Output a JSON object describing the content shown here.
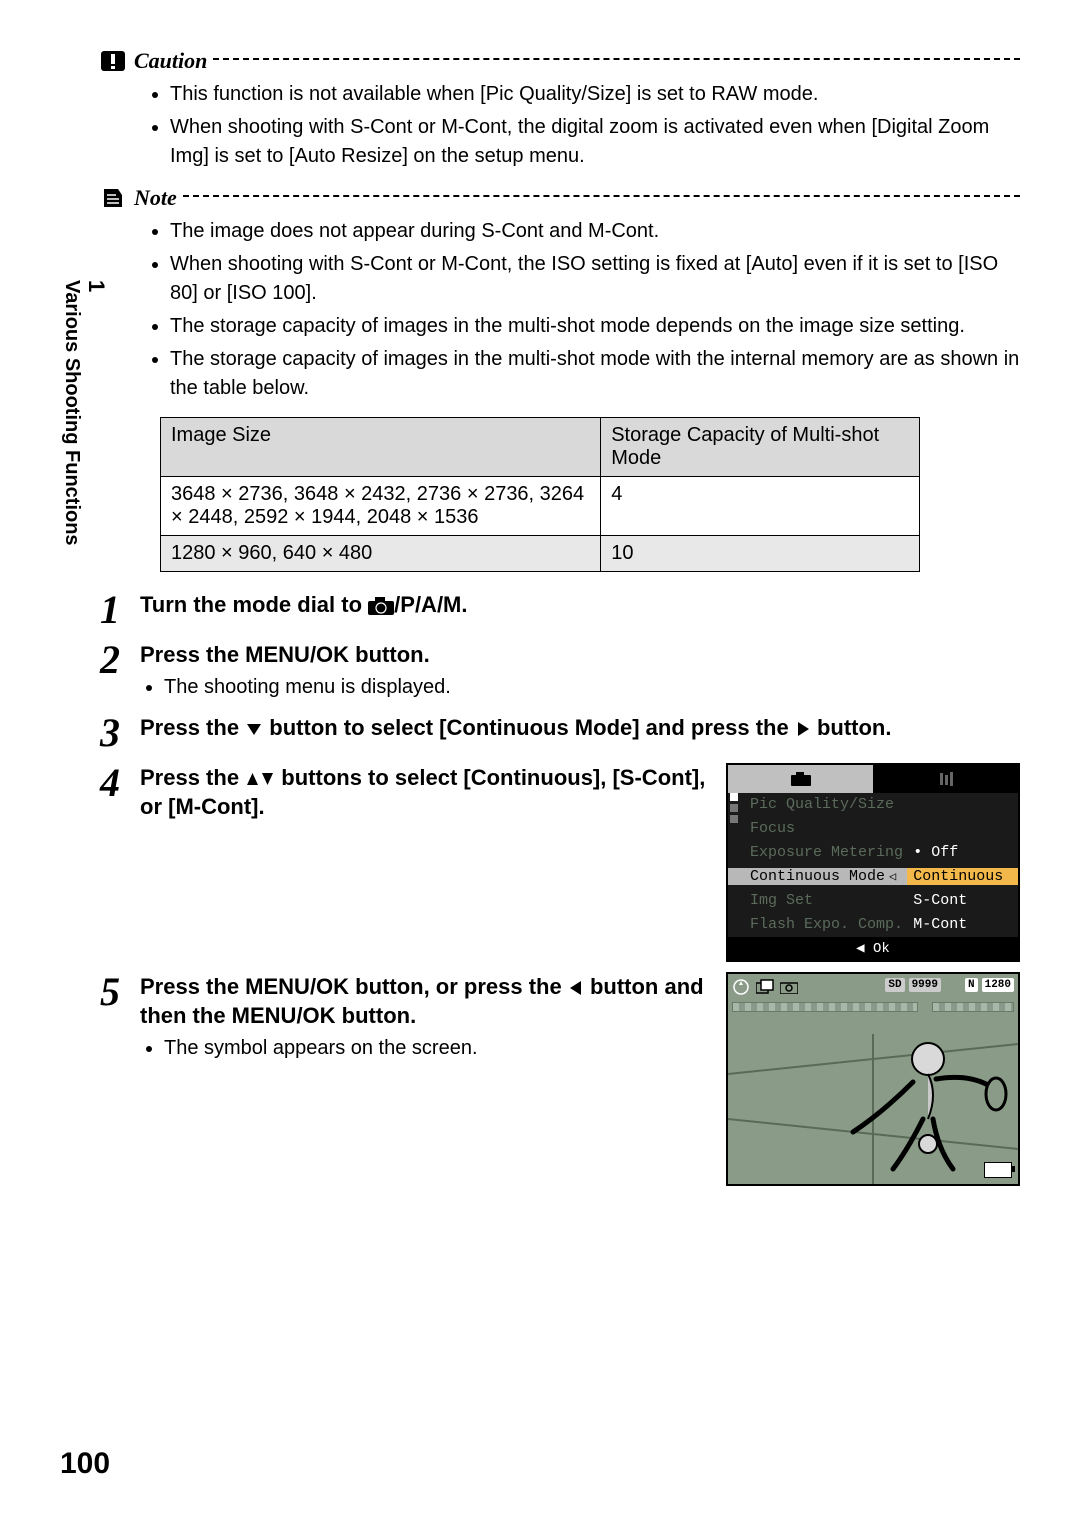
{
  "side": {
    "num": "1",
    "title": "Various Shooting Functions"
  },
  "caution": {
    "heading": "Caution",
    "items": [
      "This function is not available when [Pic Quality/Size] is set to RAW mode.",
      "When shooting with S-Cont or M-Cont, the digital zoom is activated even when [Digital Zoom Img] is set to [Auto Resize] on the setup menu."
    ]
  },
  "note": {
    "heading": "Note",
    "items": [
      "The image does not appear during S-Cont and M-Cont.",
      "When shooting with S-Cont or M-Cont, the ISO setting is fixed at [Auto] even if it is set to [ISO 80] or [ISO 100].",
      "The storage capacity of images in the multi-shot mode depends on the image size setting.",
      "The storage capacity of images in the multi-shot mode with the internal memory are as shown in the table below."
    ]
  },
  "table": {
    "headers": [
      "Image Size",
      "Storage Capacity of Multi-shot Mode"
    ],
    "rows": [
      [
        "3648 × 2736, 3648 × 2432, 2736 × 2736, 3264 × 2448, 2592 × 1944, 2048 × 1536",
        "4"
      ],
      [
        "1280 × 960, 640 × 480",
        "10"
      ]
    ]
  },
  "steps": [
    {
      "num": "1",
      "title_pre": "Turn the mode dial to ",
      "title_post": "/P/A/M."
    },
    {
      "num": "2",
      "title": "Press the MENU/OK button.",
      "bullets": [
        "The shooting menu is displayed."
      ]
    },
    {
      "num": "3",
      "title_parts": [
        "Press the ",
        " button to select [Continuous Mode] and press the ",
        " button."
      ]
    },
    {
      "num": "4",
      "title_parts": [
        "Press the ",
        " buttons to select [Continuous], [S-Cont], or [M-Cont]."
      ]
    },
    {
      "num": "5",
      "title_parts": [
        "Press the MENU/OK button, or press the ",
        " button and then the MENU/OK button."
      ],
      "bullets": [
        "The symbol appears on the screen."
      ]
    }
  ],
  "menu": {
    "items": [
      {
        "l": "Pic Quality/Size",
        "r": ""
      },
      {
        "l": "Focus",
        "r": ""
      },
      {
        "l": "Exposure Metering",
        "r": "• Off"
      },
      {
        "l": "Continuous Mode",
        "r": "Continuous",
        "sel": true
      },
      {
        "l": "Img Set",
        "r": "S-Cont"
      },
      {
        "l": "Flash Expo. Comp.",
        "r": "M-Cont"
      }
    ],
    "ok": "◀ Ok"
  },
  "camera": {
    "sd": "SD",
    "count": "9999",
    "n": "N",
    "size": "1280"
  },
  "page": "100"
}
